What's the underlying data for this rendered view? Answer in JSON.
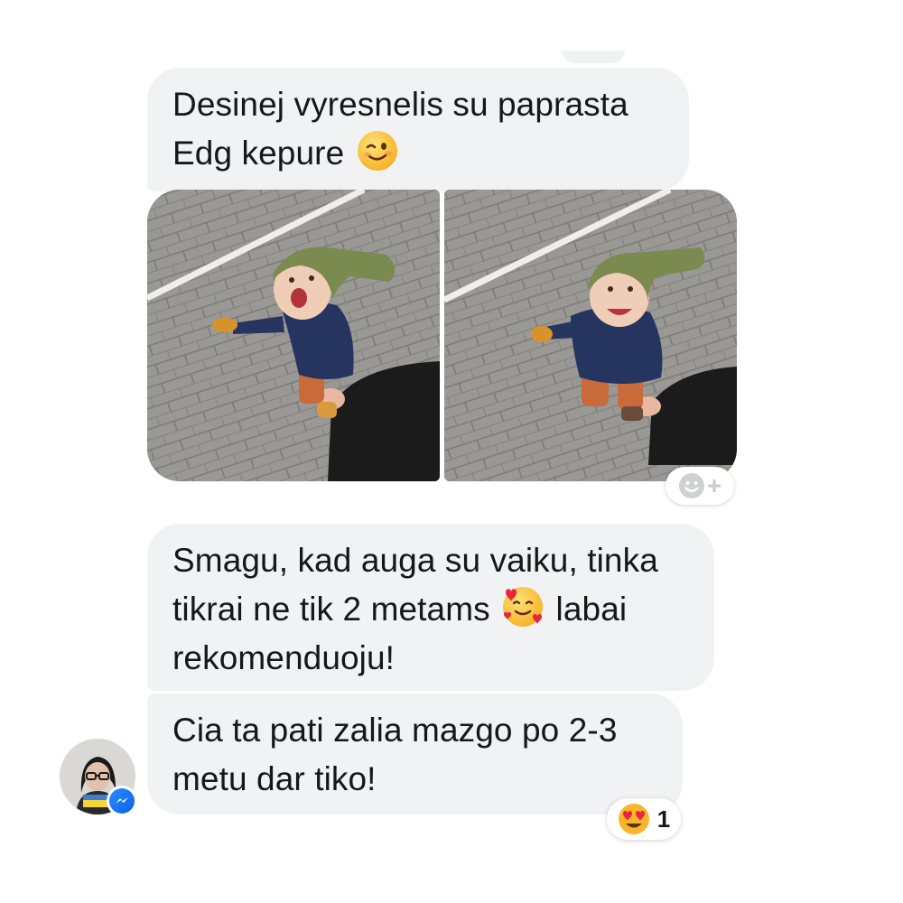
{
  "messages": [
    {
      "line1": "Desinej vyresnelis su paprasta",
      "line2": "Edg kepure",
      "emoji": "winking-face-emoji"
    },
    {
      "line1": "Smagu, kad auga su vaiku, tinka",
      "line2_a": "tikrai ne tik 2 metams",
      "line2_emoji": "smiling-face-with-hearts-emoji",
      "line2_b": "labai",
      "line3": "rekomenduoju!"
    },
    {
      "line1": "Cia ta pati zalia mazgo po 2-3",
      "line2": "metu dar tiko!"
    }
  ],
  "photos": [
    {
      "subject": "toddler-in-green-pointed-hat-photo",
      "position": "left"
    },
    {
      "subject": "toddler-in-green-pointed-hat-photo",
      "position": "right"
    }
  ],
  "add_reaction": {
    "icon": "smiley-icon",
    "plus": "+"
  },
  "reaction": {
    "emoji": "heart-eyes-emoji",
    "count": "1"
  },
  "avatar": {
    "badge_icon": "messenger-icon"
  },
  "colors": {
    "bubble_bg": "#f1f2f4",
    "text": "#15171a",
    "messenger_blue": "#0a63e8"
  }
}
